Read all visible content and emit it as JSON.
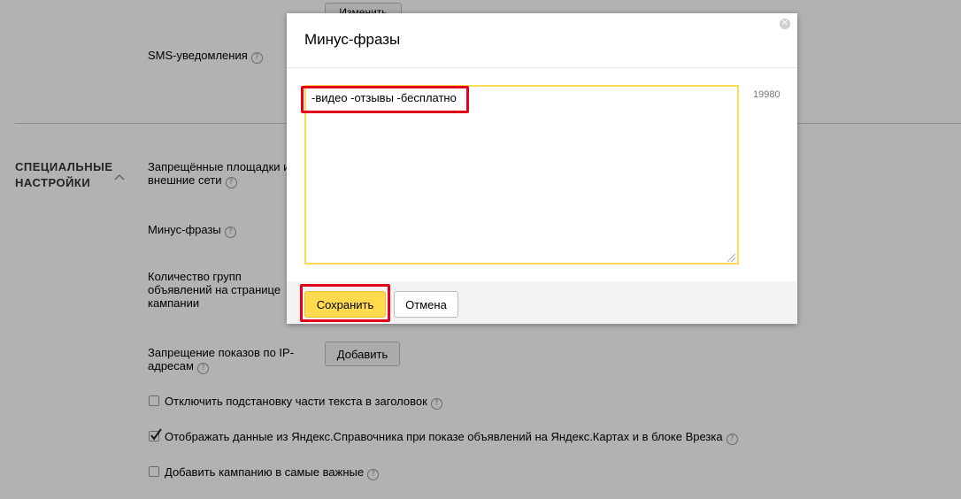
{
  "background": {
    "top_button_label": "Изменить",
    "sms": {
      "label": "SMS-уведомления"
    },
    "special_section": {
      "title_line1": "СПЕЦИАЛЬНЫЕ",
      "title_line2": "НАСТРОЙКИ"
    },
    "blocked_sites": {
      "line1": "Запрещённые площадки и",
      "line2": "внешние сети"
    },
    "minus_phrases": {
      "label": "Минус-фразы"
    },
    "group_count": {
      "line1": "Количество групп",
      "line2": "объявлений на странице",
      "line3": "кампании"
    },
    "ip_block": {
      "line1": "Запрещение показов по IP-",
      "line2": "адресам",
      "button": "Добавить"
    },
    "checkboxes": [
      {
        "label": "Отключить подстановку части текста в заголовок",
        "checked": false
      },
      {
        "label": "Отображать данные из Яндекс.Справочника при показе объявлений на Яндекс.Картах и в блоке Врезка",
        "checked": true
      },
      {
        "label": "Добавить кампанию в самые важные",
        "checked": false
      }
    ]
  },
  "modal": {
    "title": "Минус-фразы",
    "textarea_value": "-видео -отзывы -бесплатно",
    "counter": "19980",
    "save_label": "Сохранить",
    "cancel_label": "Отмена"
  },
  "icons": {
    "help": "question-circle-icon",
    "close": "close-circle-icon",
    "chevron": "chevron-up-icon",
    "check": "checkmark-icon"
  },
  "colors": {
    "accent_yellow": "#ffdb4d",
    "highlight_red": "#e3001b",
    "overlay": "rgba(0,0,0,0.3)"
  }
}
